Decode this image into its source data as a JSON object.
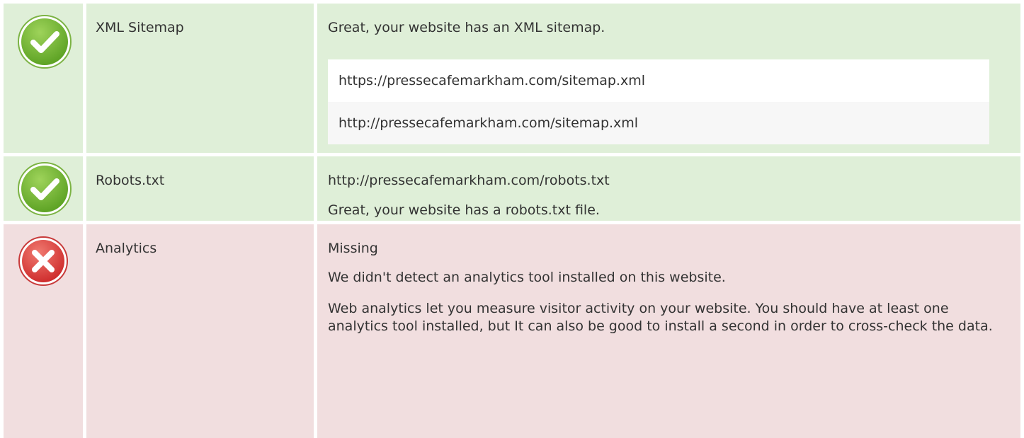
{
  "checks": {
    "sitemap": {
      "label": "XML Sitemap",
      "status": "pass",
      "icon": "check-circle-icon",
      "message": "Great, your website has an XML sitemap.",
      "urls": [
        "https://pressecafemarkham.com/sitemap.xml",
        "http://pressecafemarkham.com/sitemap.xml"
      ]
    },
    "robots": {
      "label": "Robots.txt",
      "status": "pass",
      "icon": "check-circle-icon",
      "url": "http://pressecafemarkham.com/robots.txt",
      "message": "Great, your website has a robots.txt file."
    },
    "analytics": {
      "label": "Analytics",
      "status": "fail",
      "icon": "error-circle-icon",
      "result": "Missing",
      "message": "We didn't detect an analytics tool installed on this website.",
      "advice": "Web analytics let you measure visitor activity on your website. You should have at least one analytics tool installed, but It can also be good to install a second in order to cross-check the data."
    }
  },
  "colors": {
    "pass_background": "#dfefd8",
    "fail_background": "#f1dedf",
    "pass_icon": "#6cb030",
    "fail_icon": "#d93a3a",
    "text": "#333333"
  }
}
